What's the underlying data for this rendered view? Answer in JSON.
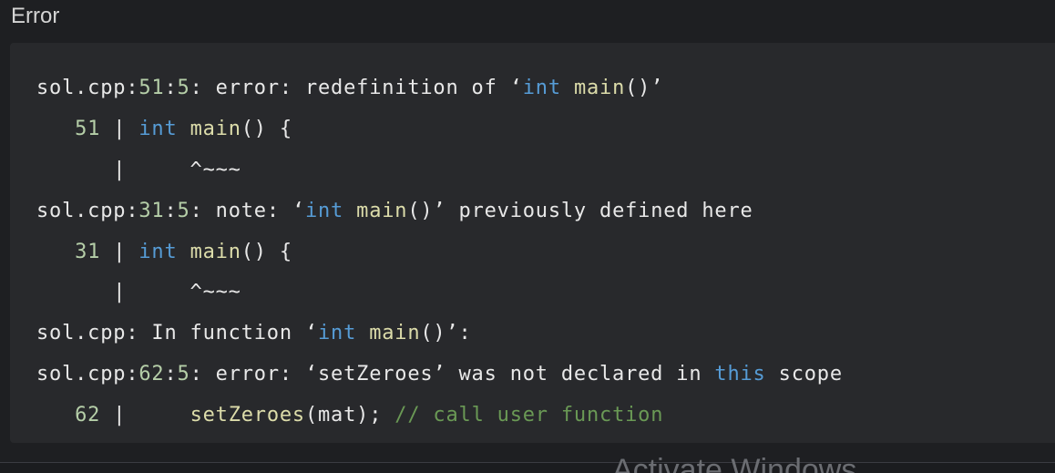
{
  "header": {
    "title": "Error"
  },
  "lines": [
    {
      "tokens": [
        {
          "text": "sol.cpp:",
          "c": "t"
        },
        {
          "text": "51",
          "c": "num"
        },
        {
          "text": ":",
          "c": "t"
        },
        {
          "text": "5",
          "c": "num"
        },
        {
          "text": ": error: redefinition of ‘",
          "c": "t"
        },
        {
          "text": "int",
          "c": "kw"
        },
        {
          "text": " ",
          "c": "t"
        },
        {
          "text": "main",
          "c": "fn"
        },
        {
          "text": "()’",
          "c": "t"
        }
      ]
    },
    {
      "tokens": [
        {
          "text": "   ",
          "c": "t"
        },
        {
          "text": "51",
          "c": "num"
        },
        {
          "text": " | ",
          "c": "t"
        },
        {
          "text": "int",
          "c": "kw"
        },
        {
          "text": " ",
          "c": "t"
        },
        {
          "text": "main",
          "c": "fn"
        },
        {
          "text": "() {",
          "c": "t"
        }
      ]
    },
    {
      "tokens": [
        {
          "text": "      |     ^~~~",
          "c": "t"
        }
      ]
    },
    {
      "tokens": [
        {
          "text": "sol.cpp:",
          "c": "t"
        },
        {
          "text": "31",
          "c": "num"
        },
        {
          "text": ":",
          "c": "t"
        },
        {
          "text": "5",
          "c": "num"
        },
        {
          "text": ": note: ‘",
          "c": "t"
        },
        {
          "text": "int",
          "c": "kw"
        },
        {
          "text": " ",
          "c": "t"
        },
        {
          "text": "main",
          "c": "fn"
        },
        {
          "text": "()’ previously defined here",
          "c": "t"
        }
      ]
    },
    {
      "tokens": [
        {
          "text": "   ",
          "c": "t"
        },
        {
          "text": "31",
          "c": "num"
        },
        {
          "text": " | ",
          "c": "t"
        },
        {
          "text": "int",
          "c": "kw"
        },
        {
          "text": " ",
          "c": "t"
        },
        {
          "text": "main",
          "c": "fn"
        },
        {
          "text": "() {",
          "c": "t"
        }
      ]
    },
    {
      "tokens": [
        {
          "text": "      |     ^~~~",
          "c": "t"
        }
      ]
    },
    {
      "tokens": [
        {
          "text": "sol.cpp: In function ‘",
          "c": "t"
        },
        {
          "text": "int",
          "c": "kw"
        },
        {
          "text": " ",
          "c": "t"
        },
        {
          "text": "main",
          "c": "fn"
        },
        {
          "text": "()’:",
          "c": "t"
        }
      ]
    },
    {
      "tokens": [
        {
          "text": "sol.cpp:",
          "c": "t"
        },
        {
          "text": "62",
          "c": "num"
        },
        {
          "text": ":",
          "c": "t"
        },
        {
          "text": "5",
          "c": "num"
        },
        {
          "text": ": error: ‘setZeroes’ was not declared in ",
          "c": "t"
        },
        {
          "text": "this",
          "c": "kw"
        },
        {
          "text": " scope",
          "c": "t"
        }
      ]
    },
    {
      "tokens": [
        {
          "text": "   ",
          "c": "t"
        },
        {
          "text": "62",
          "c": "num"
        },
        {
          "text": " |     ",
          "c": "t"
        },
        {
          "text": "setZeroes",
          "c": "fn"
        },
        {
          "text": "(mat); ",
          "c": "t"
        },
        {
          "text": "// call user function",
          "c": "cm"
        }
      ]
    }
  ],
  "watermark": {
    "text": "Activate Windows"
  },
  "colors": {
    "background": "#1e1f22",
    "panel": "#28292c",
    "text": "#e8e8e8",
    "number": "#b5cea8",
    "keyword": "#569cd6",
    "function": "#dcdcaa",
    "comment": "#6a9955"
  }
}
